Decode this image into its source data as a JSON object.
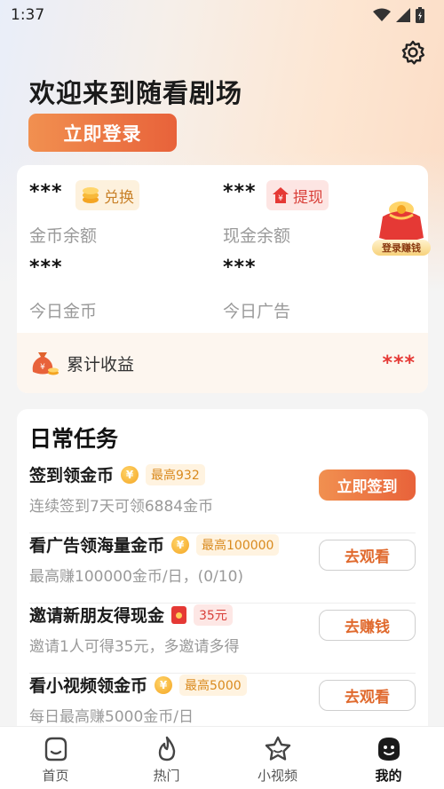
{
  "status_bar": {
    "time": "1:37"
  },
  "header": {
    "welcome": "欢迎来到随看剧场",
    "login_button": "立即登录"
  },
  "wallet": {
    "coin_balance_value": "***",
    "coin_balance_label": "金币余额",
    "exchange_label": "兑换",
    "cash_balance_value": "***",
    "cash_balance_label": "现金余额",
    "withdraw_label": "提现",
    "today_coins_value": "***",
    "today_coins_label": "今日金币",
    "today_ads_value": "***",
    "today_ads_label": "今日广告",
    "promo_label": "登录赚钱",
    "total_label": "累计收益",
    "total_value": "***"
  },
  "tasks": {
    "title": "日常任务",
    "items": [
      {
        "title": "签到领金币",
        "tag": "最高932",
        "desc": "连续签到7天可领6884金币",
        "button": "立即签到"
      },
      {
        "title": "看广告领海量金币",
        "tag": "最高100000",
        "desc": "最高赚100000金币/日，(0/10)",
        "button": "去观看"
      },
      {
        "title": "邀请新朋友得现金",
        "tag": "35元",
        "desc": "邀请1人可得35元，多邀请多得",
        "button": "去赚钱"
      },
      {
        "title": "看小视频领金币",
        "tag": "最高5000",
        "desc": "每日最高赚5000金币/日",
        "button": "去观看"
      }
    ]
  },
  "nav": {
    "items": [
      {
        "label": "首页",
        "icon": "home-icon"
      },
      {
        "label": "热门",
        "icon": "flame-icon"
      },
      {
        "label": "小视频",
        "icon": "star-icon"
      },
      {
        "label": "我的",
        "icon": "profile-icon"
      }
    ],
    "active": "我的"
  },
  "colors": {
    "accent": "#e8623a",
    "accent_light": "#f19050",
    "red": "#e53935",
    "gold": "#d98a1e"
  }
}
